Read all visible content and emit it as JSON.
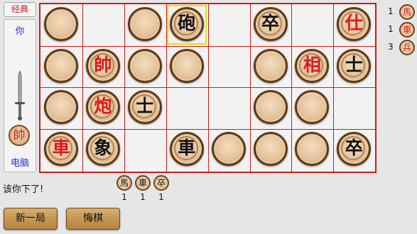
{
  "mode_label": "经典",
  "side_panel": {
    "you_label": "你",
    "cpu_label": "电脑",
    "turn_piece": "帥",
    "sword": "sword-icon"
  },
  "board": {
    "cols": 8,
    "rows": 4,
    "selected": {
      "row": 0,
      "col": 3
    },
    "pieces": [
      {
        "row": 0,
        "col": 0,
        "side": "hidden",
        "char": ""
      },
      {
        "row": 0,
        "col": 2,
        "side": "hidden",
        "char": ""
      },
      {
        "row": 0,
        "col": 3,
        "side": "black",
        "char": "砲"
      },
      {
        "row": 0,
        "col": 5,
        "side": "black",
        "char": "卒"
      },
      {
        "row": 0,
        "col": 7,
        "side": "red",
        "char": "仕"
      },
      {
        "row": 1,
        "col": 0,
        "side": "hidden",
        "char": ""
      },
      {
        "row": 1,
        "col": 1,
        "side": "red",
        "char": "帥"
      },
      {
        "row": 1,
        "col": 2,
        "side": "hidden",
        "char": ""
      },
      {
        "row": 1,
        "col": 3,
        "side": "hidden",
        "char": ""
      },
      {
        "row": 1,
        "col": 5,
        "side": "hidden",
        "char": ""
      },
      {
        "row": 1,
        "col": 6,
        "side": "red",
        "char": "相"
      },
      {
        "row": 1,
        "col": 7,
        "side": "black",
        "char": "士"
      },
      {
        "row": 2,
        "col": 0,
        "side": "hidden",
        "char": ""
      },
      {
        "row": 2,
        "col": 1,
        "side": "red",
        "char": "炮"
      },
      {
        "row": 2,
        "col": 2,
        "side": "black",
        "char": "士"
      },
      {
        "row": 2,
        "col": 5,
        "side": "hidden",
        "char": ""
      },
      {
        "row": 2,
        "col": 6,
        "side": "hidden",
        "char": ""
      },
      {
        "row": 3,
        "col": 0,
        "side": "red",
        "char": "車"
      },
      {
        "row": 3,
        "col": 1,
        "side": "black",
        "char": "象"
      },
      {
        "row": 3,
        "col": 3,
        "side": "black",
        "char": "車"
      },
      {
        "row": 3,
        "col": 4,
        "side": "hidden",
        "char": ""
      },
      {
        "row": 3,
        "col": 5,
        "side": "hidden",
        "char": ""
      },
      {
        "row": 3,
        "col": 6,
        "side": "hidden",
        "char": ""
      },
      {
        "row": 3,
        "col": 7,
        "side": "black",
        "char": "卒"
      }
    ]
  },
  "captured_red": [
    {
      "count": "1",
      "char": "馬"
    },
    {
      "count": "1",
      "char": "車"
    },
    {
      "count": "3",
      "char": "兵"
    }
  ],
  "captured_black": [
    {
      "count": "1",
      "char": "馬"
    },
    {
      "count": "1",
      "char": "車"
    },
    {
      "count": "1",
      "char": "卒"
    }
  ],
  "status": "该你下了!",
  "buttons": {
    "new_game": "新一局",
    "undo": "悔棋"
  },
  "colors": {
    "board_border": "#d81818",
    "red_piece_text": "#e01818",
    "black_piece_text": "#111111",
    "selection": "#e5e500",
    "label_blue": "#2030d0",
    "button_wood": "#c89653"
  }
}
